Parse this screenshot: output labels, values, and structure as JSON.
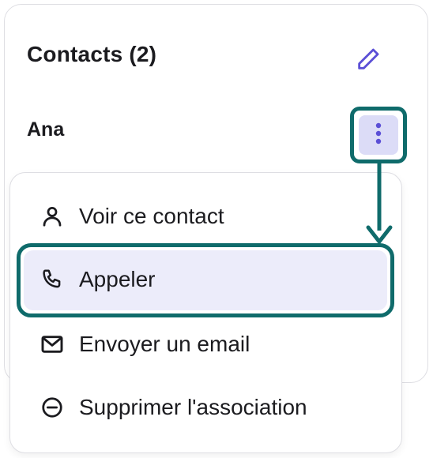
{
  "card": {
    "title": "Contacts (2)",
    "edit_icon": "pencil-icon",
    "contact_name": "Ana",
    "more_icon": "vertical-ellipsis-icon"
  },
  "menu": {
    "items": [
      {
        "label": "Voir ce contact",
        "icon": "user-icon"
      },
      {
        "label": "Appeler",
        "icon": "phone-icon"
      },
      {
        "label": "Envoyer un email",
        "icon": "envelope-icon"
      },
      {
        "label": "Supprimer l'association",
        "icon": "minus-circle-icon"
      }
    ]
  },
  "colors": {
    "highlight_border": "#0f6b6b",
    "accent_purple": "#5b4fd6",
    "menu_button_bg": "#dcdcf7",
    "hover_bg": "#ececfa"
  }
}
